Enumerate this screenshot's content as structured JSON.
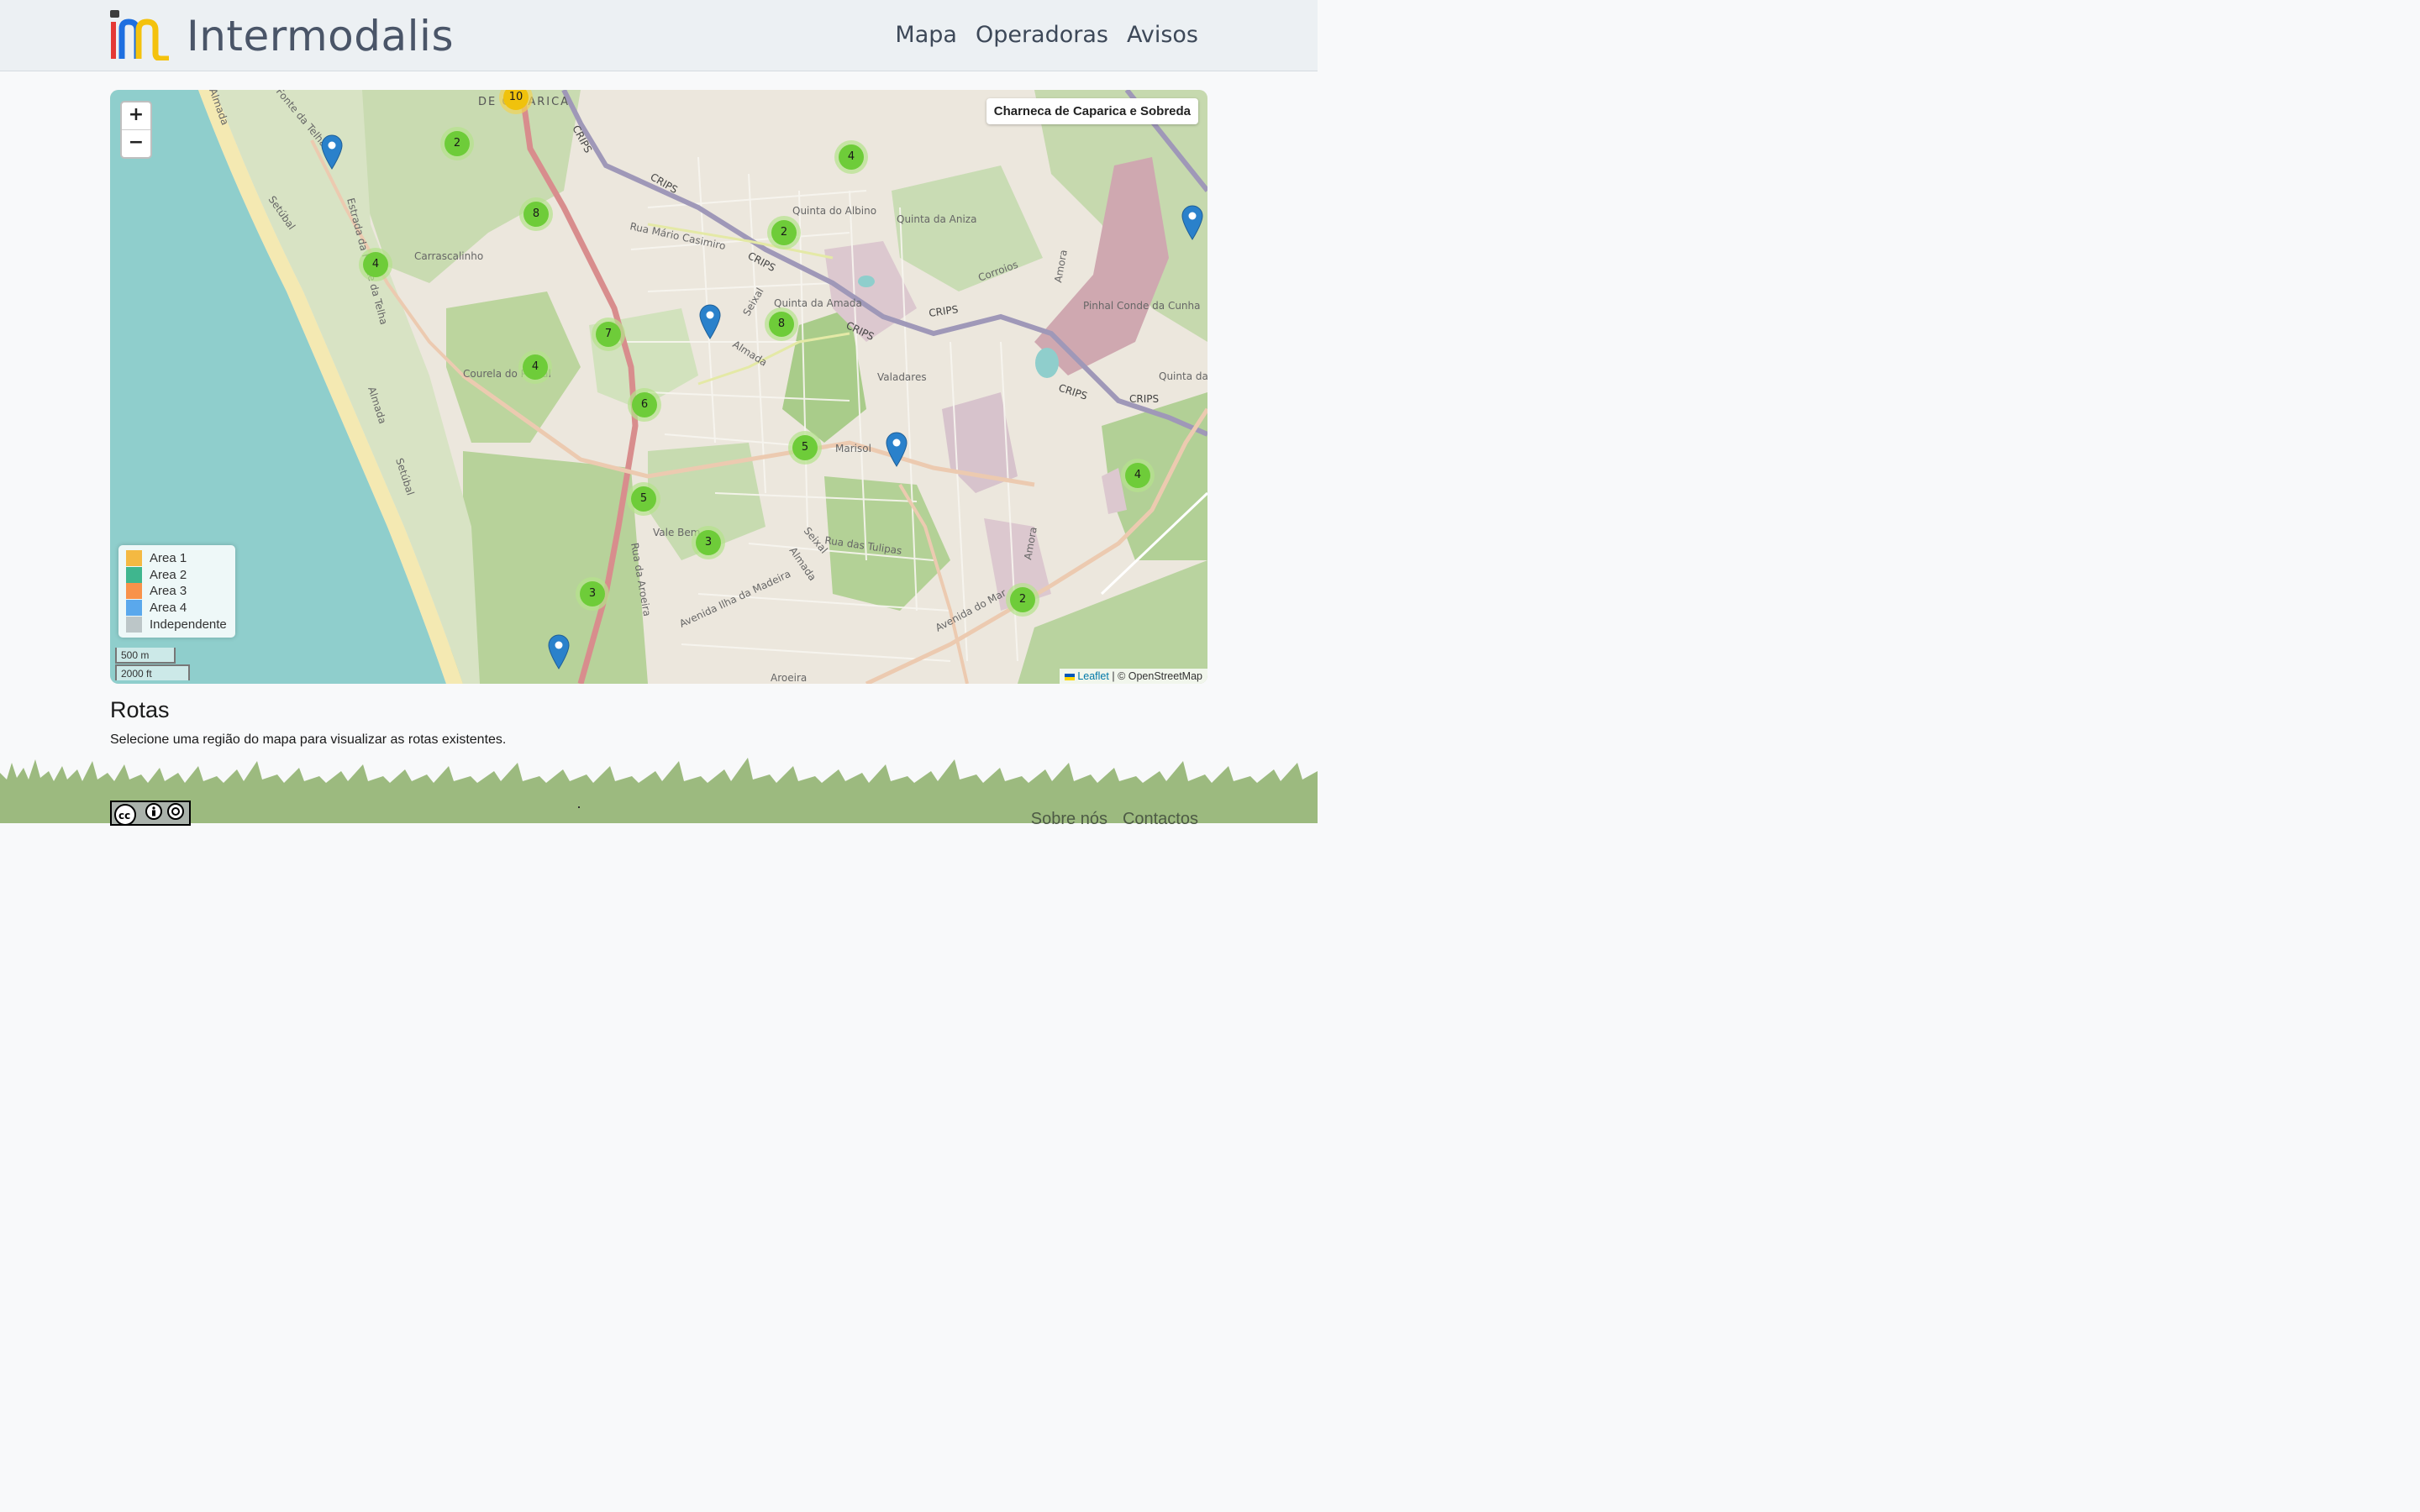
{
  "app": {
    "name": "Intermodalis"
  },
  "nav": {
    "items": [
      "Mapa",
      "Operadoras",
      "Avisos"
    ]
  },
  "map": {
    "region_label": "Charneca de Caparica e Sobreda",
    "zoom_in": "+",
    "zoom_out": "−",
    "place_labels": {
      "de_caparica": "DE CAPARICA",
      "crips": "CRIPS",
      "rua_mario": "Rua Mário Casimiro",
      "carrascalinho": "Carrascalinho",
      "quinta_albino": "Quinta do Albino",
      "quinta_aniza": "Quinta da Aniza",
      "quinta_amada": "Quinta da Amada",
      "corroios": "Corroios",
      "pinhal_conde": "Pinhal Conde da Cunha",
      "valadares": "Valadares",
      "marisol": "Marisol",
      "courela": "Courela do Pinhal",
      "vale_bem": "Vale Bem",
      "rua_tulipas": "Rua das Tulipas",
      "av_madeira": "Avenida Ilha da Madeira",
      "rua_aroeira": "Rua da Aroeira",
      "aroeira": "Aroeira",
      "almada": "Almada",
      "setubal": "Setúbal",
      "fonte_telha": "Fonte da Telha",
      "estrada_fonte": "Estrada da Fonte da Telha",
      "seixal": "Seixal",
      "amora": "Amora",
      "quinta_charnequinha": "Quinta da Charnequinha",
      "av_mar": "Avenida do Mar"
    },
    "clusters": [
      "10",
      "2",
      "4",
      "2",
      "8",
      "4",
      "7",
      "8",
      "4",
      "6",
      "5",
      "5",
      "3",
      "3",
      "4",
      "2"
    ],
    "legend": [
      {
        "label": "Area 1",
        "color": "#f4b942"
      },
      {
        "label": "Area 2",
        "color": "#3fb68e"
      },
      {
        "label": "Area 3",
        "color": "#f8924a"
      },
      {
        "label": "Area 4",
        "color": "#5aa8ec"
      },
      {
        "label": "Independente",
        "color": "#bcc6c8"
      }
    ],
    "scale": {
      "metric": "500 m",
      "imperial": "2000 ft"
    },
    "attribution": {
      "leaflet": "Leaflet",
      "rest": "| © OpenStreetMap"
    }
  },
  "content": {
    "title": "Rotas",
    "description": "Selecione uma região do mapa para visualizar as rotas existentes."
  },
  "footer": {
    "links": [
      "Sobre nós",
      "Contactos"
    ]
  }
}
